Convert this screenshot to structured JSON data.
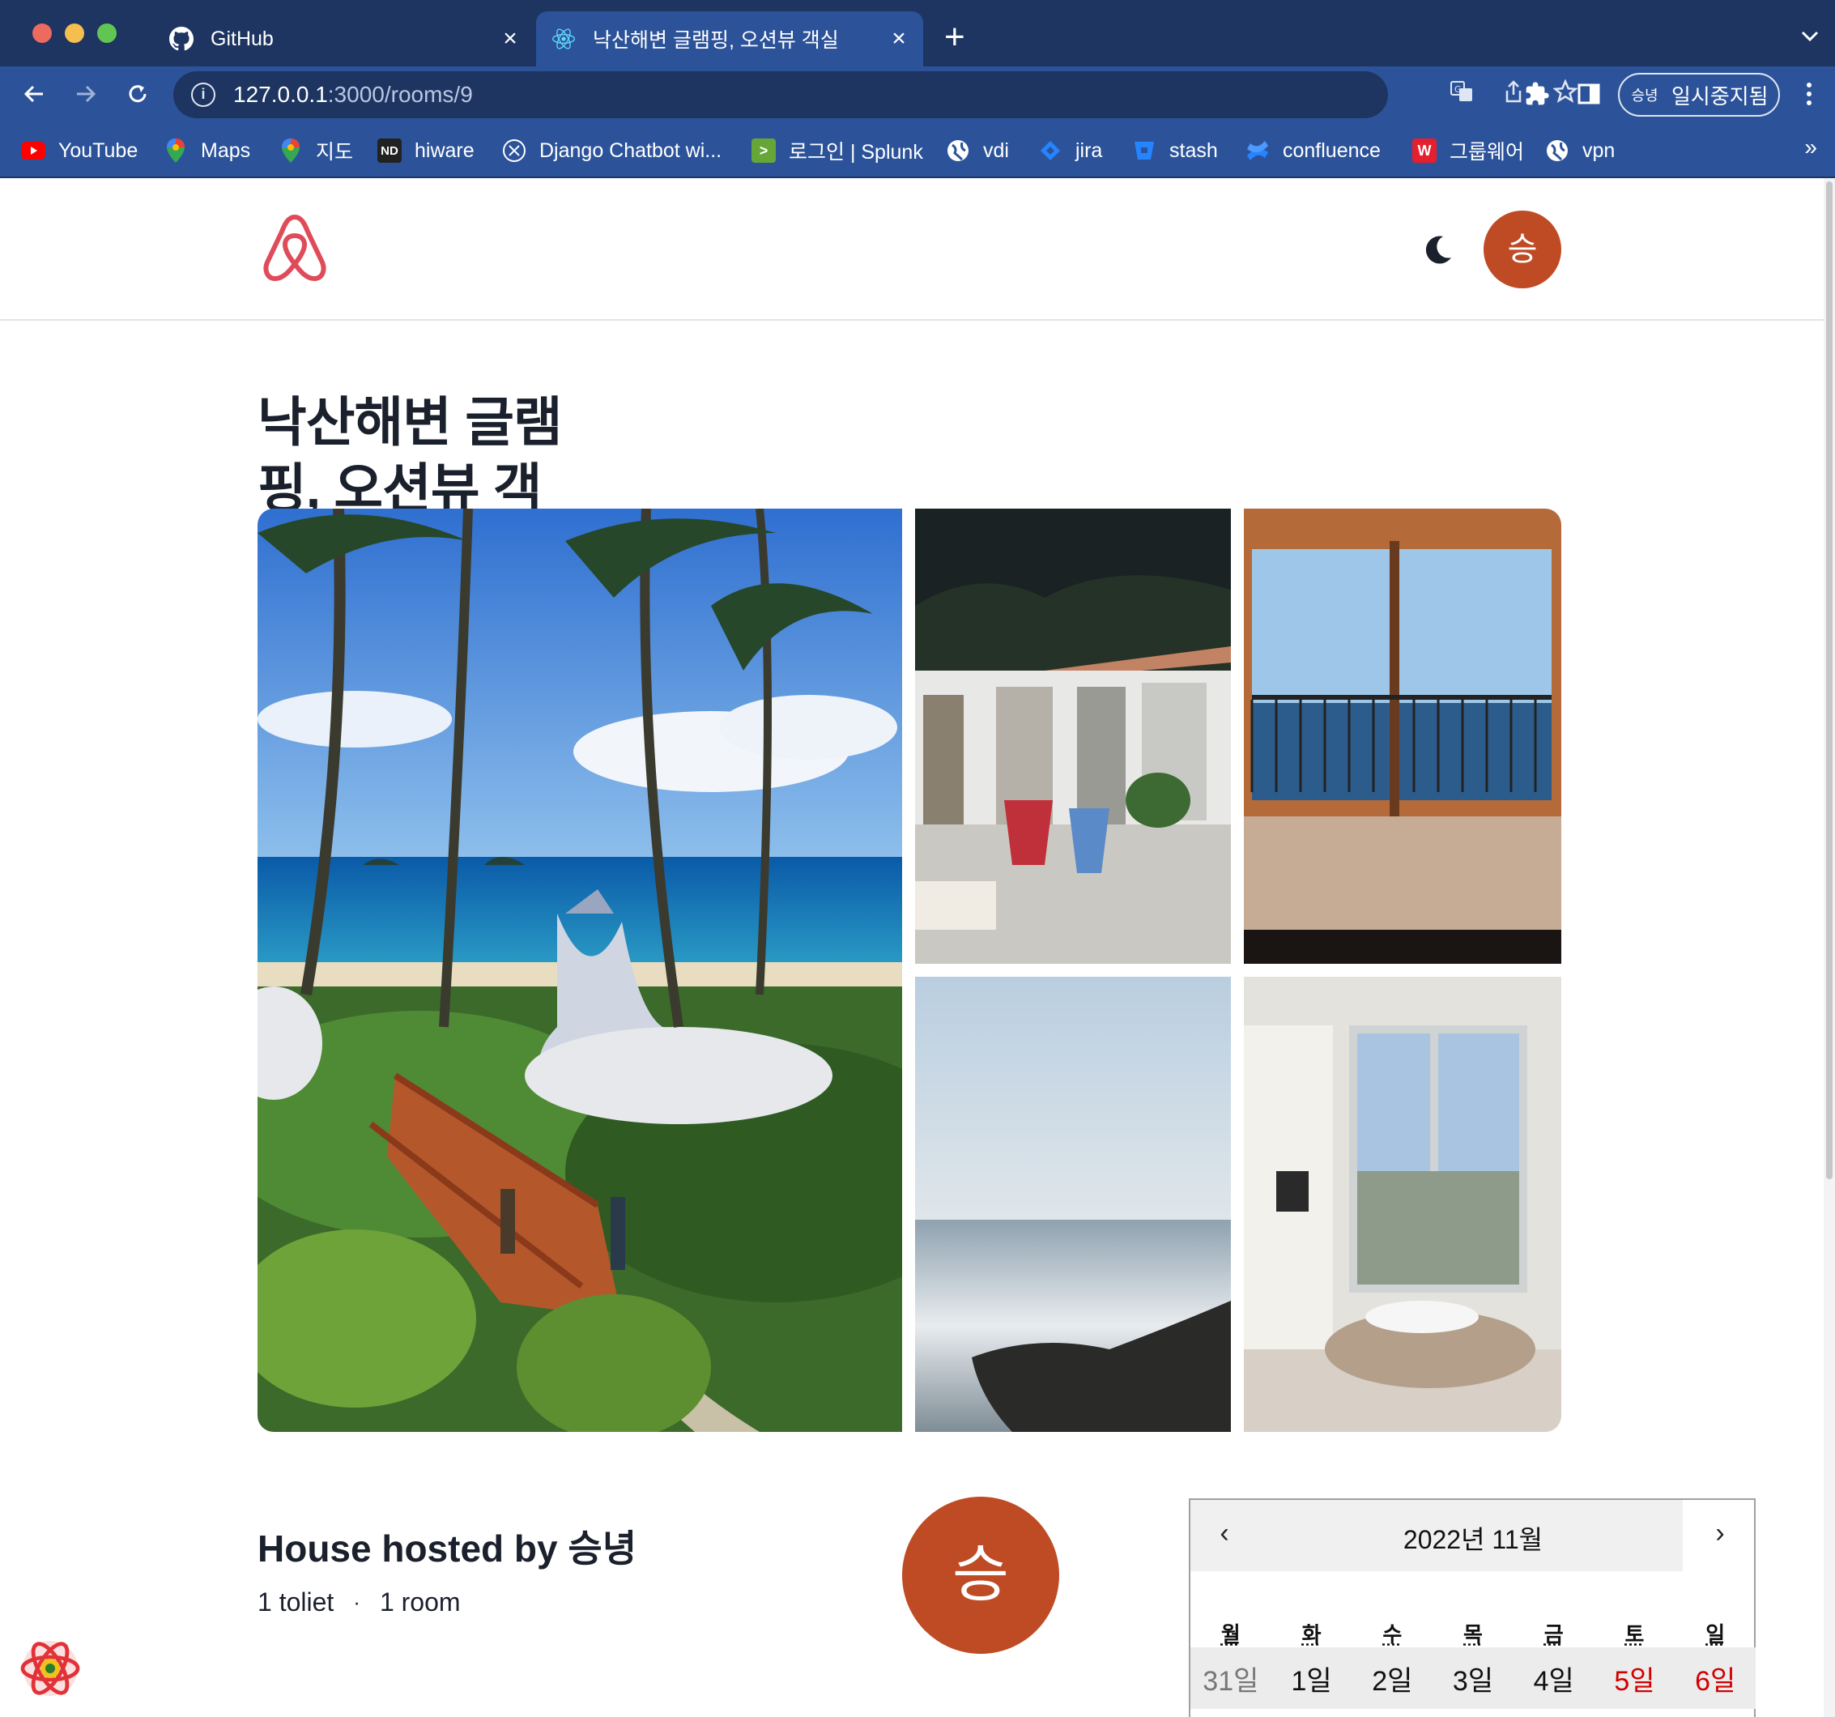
{
  "browser": {
    "tabs": [
      {
        "title": "GitHub",
        "icon": "github-icon",
        "active": false
      },
      {
        "title": "낙산해변 글램핑, 오션뷰 객실",
        "icon": "react-icon",
        "active": true
      }
    ],
    "url_host": "127.0.0.1",
    "url_path": ":3000/rooms/9",
    "profile_avatar": "승녕",
    "profile_status": "일시중지됨",
    "bookmarks": [
      {
        "label": "YouTube",
        "icon": "youtube-icon",
        "color": "#ff0000"
      },
      {
        "label": "Maps",
        "icon": "maps-icon",
        "color": "#34a853"
      },
      {
        "label": "지도",
        "icon": "maps-icon",
        "color": "#34a853"
      },
      {
        "label": "hiware",
        "icon": "nd-icon",
        "color": "#222222"
      },
      {
        "label": "Django Chatbot wi...",
        "icon": "openai-icon",
        "color": "#000000"
      },
      {
        "label": "로그인 | Splunk",
        "icon": "splunk-icon",
        "color": "#65a637"
      },
      {
        "label": "vdi",
        "icon": "globe-icon",
        "color": "#ffffff"
      },
      {
        "label": "jira",
        "icon": "jira-icon",
        "color": "#2684ff"
      },
      {
        "label": "stash",
        "icon": "stash-icon",
        "color": "#2684ff"
      },
      {
        "label": "confluence",
        "icon": "confluence-icon",
        "color": "#2684ff"
      },
      {
        "label": "그룹웨어",
        "icon": "groupware-icon",
        "color": "#e5202e"
      },
      {
        "label": "vpn",
        "icon": "globe-icon",
        "color": "#ffffff"
      }
    ],
    "bookmarks_more": "»"
  },
  "site": {
    "brand_color": "#e04b5a",
    "avatar_color": "#bf4b25",
    "header_avatar": "승"
  },
  "room": {
    "title": "낙산해변 글램핑, 오션뷰 객실",
    "photos": [
      "tropical beach glamping tents with wooden bridge and palm trees",
      "patio with camping chairs under night sky",
      "bedroom with ocean view through balcony door",
      "ocean horizon with rocky shore",
      "apartment room with tall windows and round rug"
    ],
    "host_heading": "House hosted by 승녕",
    "toilets": "1 toliet",
    "rooms": "1 room",
    "meta_separator": "·",
    "host_avatar": "승"
  },
  "calendar": {
    "month_label": "2022년 11월",
    "prev": "‹",
    "next": "›",
    "weekdays": [
      "월",
      "화",
      "수",
      "목",
      "금",
      "토",
      "일"
    ],
    "first_row": [
      "31일",
      "1일",
      "2일",
      "3일",
      "4일",
      "5일",
      "6일"
    ]
  }
}
